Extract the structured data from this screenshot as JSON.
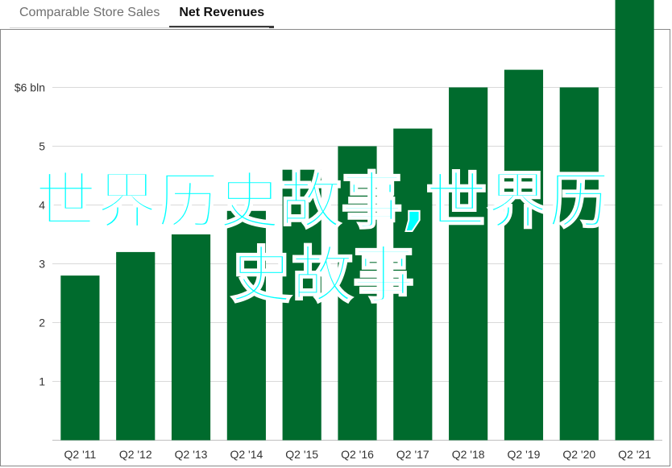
{
  "tabs": [
    {
      "label": "Comparable Store Sales",
      "active": false
    },
    {
      "label": "Net Revenues",
      "active": true
    }
  ],
  "watermark": "世界历史故事,世界历史故事",
  "chart_data": {
    "type": "bar",
    "categories": [
      "Q2 '11",
      "Q2 '12",
      "Q2 '13",
      "Q2 '14",
      "Q2 '15",
      "Q2 '16",
      "Q2 '17",
      "Q2 '18",
      "Q2 '19",
      "Q2 '20",
      "Q2 '21"
    ],
    "values": [
      2.8,
      3.2,
      3.5,
      3.9,
      4.6,
      5.0,
      5.3,
      6.0,
      6.3,
      6.0,
      8.3
    ],
    "ylim": [
      0,
      8.3
    ],
    "yticks": [
      1,
      2,
      3,
      4,
      5,
      6
    ],
    "ytick_labels": [
      "1",
      "2",
      "3",
      "4",
      "5",
      "$6 bln"
    ],
    "bar_color": "#006b2d",
    "grid": true,
    "title": "",
    "xlabel": "",
    "ylabel": ""
  }
}
